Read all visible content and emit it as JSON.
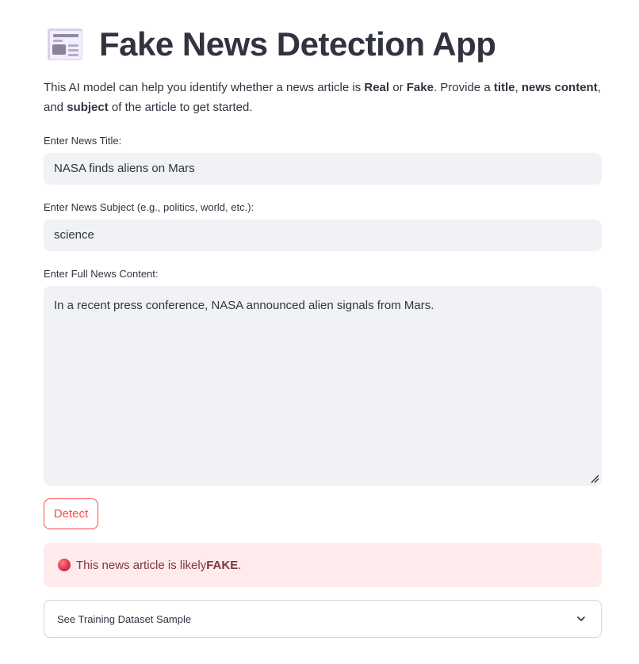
{
  "header": {
    "title": "Fake News Detection App",
    "icon": "newspaper-icon"
  },
  "intro": {
    "part1": "This AI model can help you identify whether a news article is ",
    "real": "Real",
    "or": " or ",
    "fake": "Fake",
    "part2": ". Provide a ",
    "title_word": "title",
    "comma": ", ",
    "content_word": "news content",
    "part3": ", and ",
    "subject_word": "subject",
    "part4": " of the article to get started."
  },
  "fields": {
    "title_label": "Enter News Title:",
    "title_value": "NASA finds aliens on Mars",
    "subject_label": "Enter News Subject (e.g., politics, world, etc.):",
    "subject_value": "science",
    "content_label": "Enter Full News Content:",
    "content_value": "In a recent press conference, NASA announced alien signals from Mars."
  },
  "detect_button": {
    "label": "Detect"
  },
  "result": {
    "icon": "red-circle-icon",
    "text": "This news article is likely ",
    "verdict": "FAKE",
    "end": "."
  },
  "expander": {
    "label": "See Training Dataset Sample",
    "icon": "chevron-down-icon"
  },
  "colors": {
    "primary": "#ff4b4b",
    "input_bg": "#f0f2f6",
    "error_bg": "#ffebeb",
    "error_text": "#7d353b",
    "text": "#31333f"
  }
}
